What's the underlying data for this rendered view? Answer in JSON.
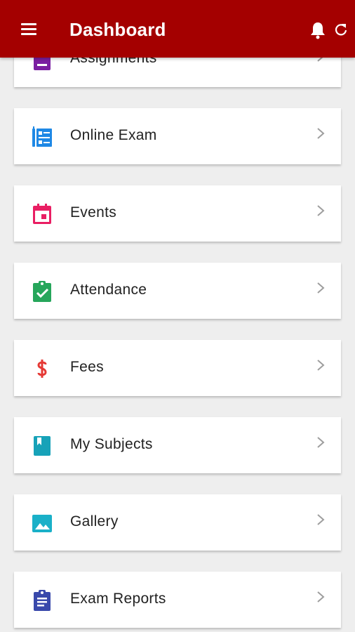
{
  "header": {
    "title": "Dashboard"
  },
  "menu": [
    {
      "id": "assignments",
      "label": "Assignments",
      "icon": "assignment-icon",
      "color": "#7b1fa2"
    },
    {
      "id": "online-exam",
      "label": "Online Exam",
      "icon": "online-exam-icon",
      "color": "#1e88e5"
    },
    {
      "id": "events",
      "label": "Events",
      "icon": "calendar-icon",
      "color": "#e91e63"
    },
    {
      "id": "attendance",
      "label": "Attendance",
      "icon": "attendance-check-icon",
      "color": "#26a65b"
    },
    {
      "id": "fees",
      "label": "Fees",
      "icon": "dollar-icon",
      "color": "#e53935"
    },
    {
      "id": "my-subjects",
      "label": "My Subjects",
      "icon": "book-icon",
      "color": "#17a2b8"
    },
    {
      "id": "gallery",
      "label": "Gallery",
      "icon": "image-icon",
      "color": "#1ab0c8"
    },
    {
      "id": "exam-reports",
      "label": "Exam Reports",
      "icon": "clipboard-icon",
      "color": "#3949ab"
    }
  ],
  "colors": {
    "appbar": "#a40000",
    "background": "#eeeeee"
  }
}
